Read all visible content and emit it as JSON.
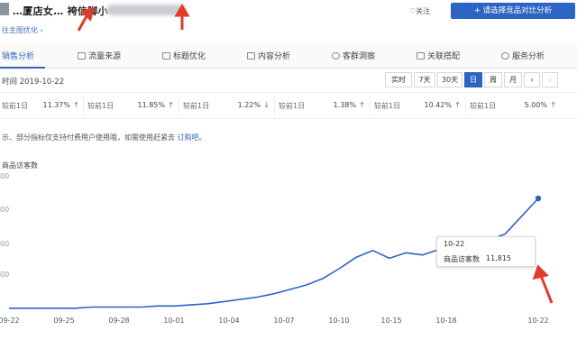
{
  "header": {
    "product_title": "…厦店女… 袴信脚小",
    "back_link": "往主图优化 ›",
    "follow_label": "♡关注",
    "compare_button": "+ 请选择竞品对比分析"
  },
  "tabs": [
    {
      "label": "销售分析",
      "active": true
    },
    {
      "label": "流量来源",
      "active": false
    },
    {
      "label": "标题优化",
      "active": false
    },
    {
      "label": "内容分析",
      "active": false
    },
    {
      "label": "客群洞察",
      "active": false
    },
    {
      "label": "关联搭配",
      "active": false
    },
    {
      "label": "服务分析",
      "active": false
    }
  ],
  "date_row": {
    "label": "时间 2019-10-22",
    "period_buttons": [
      {
        "label": "实时",
        "active": false
      },
      {
        "label": "7天",
        "active": false
      },
      {
        "label": "30天",
        "active": false
      },
      {
        "label": "日",
        "active": true
      },
      {
        "label": "周",
        "active": false
      },
      {
        "label": "月",
        "active": false
      }
    ],
    "prev_icon": "chevron-left-icon",
    "next_icon": "chevron-right-icon"
  },
  "metrics": [
    {
      "label": "较前1日",
      "value": "11.37%",
      "trend": "up"
    },
    {
      "label": "较前1日",
      "value": "11.85%",
      "trend": "up"
    },
    {
      "label": "较前1日",
      "value": "1.22%",
      "trend": "down"
    },
    {
      "label": "较前1日",
      "value": "1.38%",
      "trend": "up"
    },
    {
      "label": "较前1日",
      "value": "10.42%",
      "trend": "up"
    },
    {
      "label": "较前1日",
      "value": "5.00%",
      "trend": "up"
    }
  ],
  "notice": {
    "text": "示、部分指标仅支持付费用户使用哦，如需使用赶紧去 ",
    "link": "订购吧。"
  },
  "chart_data": {
    "type": "line",
    "metric_name": "商品访客数",
    "y_tick_labels": [
      "00",
      "00",
      "00",
      "00"
    ],
    "x_tick_labels": [
      "09-22",
      "09-25",
      "09-28",
      "10-01",
      "10-04",
      "10-07",
      "10-10",
      "10-15",
      "10-18",
      "10-22"
    ],
    "series": [
      {
        "values": [
          1,
          1,
          1,
          1,
          1,
          2,
          2,
          2,
          2,
          3,
          3,
          4,
          5,
          7,
          9,
          11,
          14,
          18,
          22,
          28,
          37,
          47,
          53,
          46,
          51,
          49,
          54,
          56,
          58,
          62,
          68,
          84,
          100
        ],
        "endpoint_marker": true
      }
    ],
    "ylim": [
      0,
      100
    ],
    "line_color": "#2d64c4",
    "tooltip": {
      "date": "10-22",
      "name": "商品访客数",
      "value": "11,815"
    }
  },
  "colors": {
    "accent": "#2d64c4",
    "up": "#e4393c",
    "down": "#2a9d4a",
    "annotation": "#e03a2a"
  }
}
